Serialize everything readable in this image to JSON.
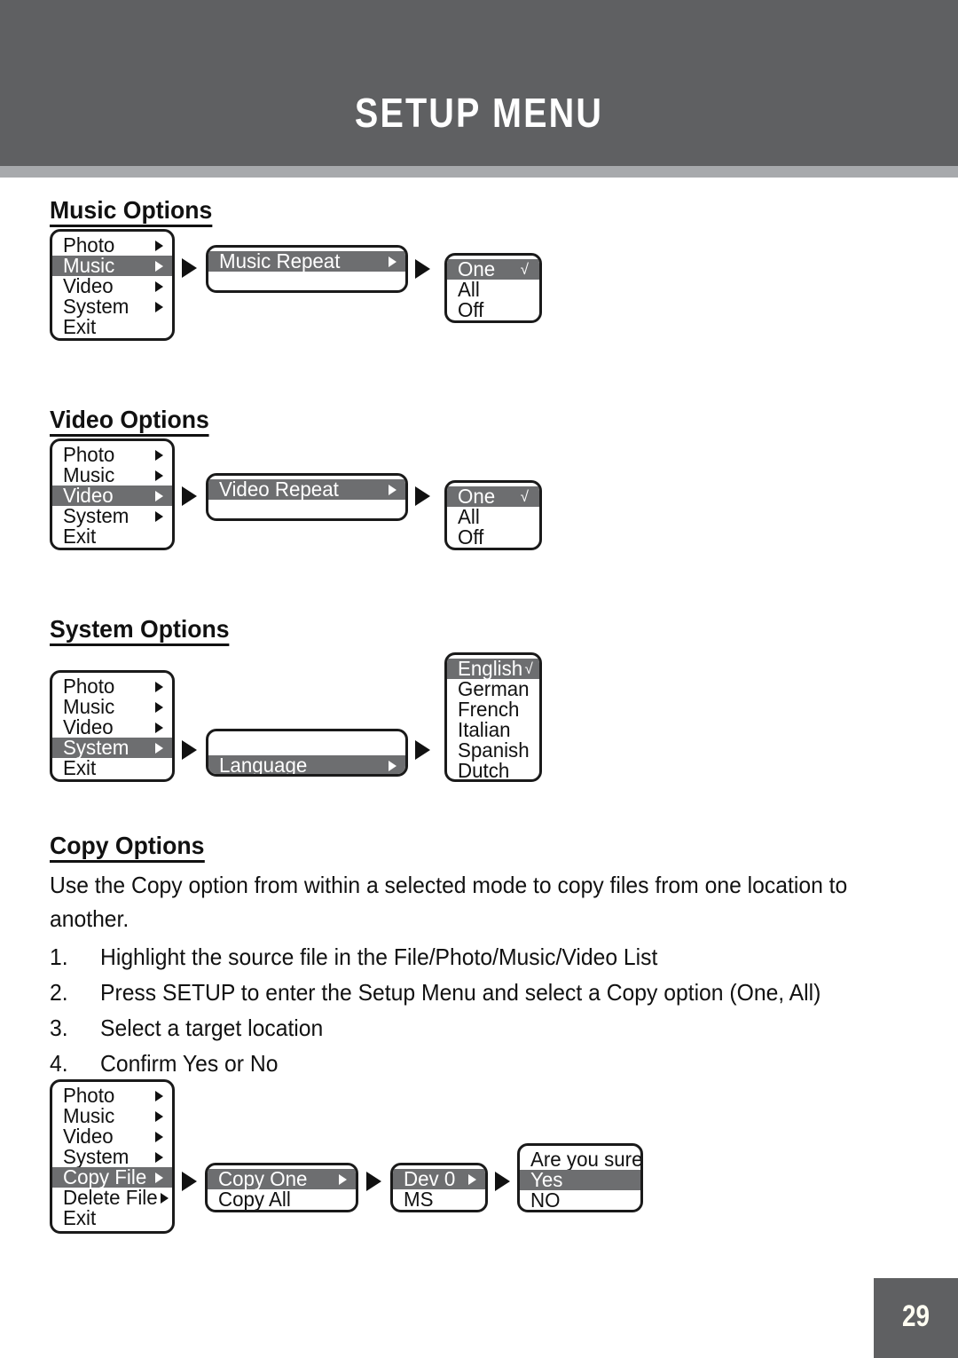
{
  "header": {
    "title": "SETUP MENU",
    "bg_color": "#5f6062",
    "rule_color": "#a7a9ac"
  },
  "page_number": "29",
  "highlight_color": "#6d6e70",
  "sections": {
    "music": {
      "heading": "Music Options",
      "main_menu": [
        {
          "label": "Photo",
          "caret": true,
          "highlighted": false
        },
        {
          "label": "Music",
          "caret": true,
          "highlighted": true
        },
        {
          "label": "Video",
          "caret": true,
          "highlighted": false
        },
        {
          "label": "System",
          "caret": true,
          "highlighted": false
        },
        {
          "label": "Exit",
          "caret": false,
          "highlighted": false
        }
      ],
      "sub_menu": [
        {
          "label": "Music Repeat",
          "caret": true,
          "highlighted": true
        },
        {
          "label": "",
          "caret": false,
          "highlighted": false
        }
      ],
      "values": [
        {
          "label": "One",
          "check": "√",
          "highlighted": true
        },
        {
          "label": "All",
          "check": "",
          "highlighted": false
        },
        {
          "label": "Off",
          "check": "",
          "highlighted": false
        }
      ]
    },
    "video": {
      "heading": "Video Options",
      "main_menu": [
        {
          "label": "Photo",
          "caret": true,
          "highlighted": false
        },
        {
          "label": "Music",
          "caret": true,
          "highlighted": false
        },
        {
          "label": "Video",
          "caret": true,
          "highlighted": true
        },
        {
          "label": "System",
          "caret": true,
          "highlighted": false
        },
        {
          "label": "Exit",
          "caret": false,
          "highlighted": false
        }
      ],
      "sub_menu": [
        {
          "label": "Video Repeat",
          "caret": true,
          "highlighted": true
        },
        {
          "label": "",
          "caret": false,
          "highlighted": false
        }
      ],
      "values": [
        {
          "label": "One",
          "check": "√",
          "highlighted": true
        },
        {
          "label": "All",
          "check": "",
          "highlighted": false
        },
        {
          "label": "Off",
          "check": "",
          "highlighted": false
        }
      ]
    },
    "system": {
      "heading": "System Options",
      "main_menu": [
        {
          "label": "Photo",
          "caret": true,
          "highlighted": false
        },
        {
          "label": "Music",
          "caret": true,
          "highlighted": false
        },
        {
          "label": "Video",
          "caret": true,
          "highlighted": false
        },
        {
          "label": "System",
          "caret": true,
          "highlighted": true
        },
        {
          "label": "Exit",
          "caret": false,
          "highlighted": false
        }
      ],
      "sub_menu": [
        {
          "label": "",
          "caret": false,
          "highlighted": false
        },
        {
          "label": "Language",
          "caret": true,
          "highlighted": true
        },
        {
          "label": "",
          "caret": false,
          "highlighted": false
        }
      ],
      "values": [
        {
          "label": "English",
          "check": "√",
          "highlighted": true
        },
        {
          "label": "German",
          "check": "",
          "highlighted": false
        },
        {
          "label": "French",
          "check": "",
          "highlighted": false
        },
        {
          "label": "Italian",
          "check": "",
          "highlighted": false
        },
        {
          "label": "Spanish",
          "check": "",
          "highlighted": false
        },
        {
          "label": "Dutch",
          "check": "",
          "highlighted": false
        }
      ]
    },
    "copy": {
      "heading": "Copy Options",
      "intro": "Use the Copy option from within a selected mode to copy files from one location to another.",
      "steps": [
        {
          "num": "1.",
          "text": "Highlight the source file in the File/Photo/Music/Video List"
        },
        {
          "num": "2.",
          "text": "Press SETUP to enter the Setup Menu and select a Copy option (One, All)"
        },
        {
          "num": "3.",
          "text": "Select a target location"
        },
        {
          "num": "4.",
          "text": "Confirm Yes or No"
        }
      ],
      "main_menu": [
        {
          "label": "Photo",
          "caret": true,
          "highlighted": false
        },
        {
          "label": "Music",
          "caret": true,
          "highlighted": false
        },
        {
          "label": "Video",
          "caret": true,
          "highlighted": false
        },
        {
          "label": "System",
          "caret": true,
          "highlighted": false
        },
        {
          "label": "Copy File",
          "caret": true,
          "highlighted": true
        },
        {
          "label": "Delete File",
          "caret": true,
          "highlighted": false
        },
        {
          "label": "Exit",
          "caret": false,
          "highlighted": false
        }
      ],
      "copy_menu": [
        {
          "label": "Copy One",
          "caret": true,
          "highlighted": true
        },
        {
          "label": "Copy All",
          "caret": false,
          "highlighted": false
        }
      ],
      "device_menu": [
        {
          "label": "Dev 0",
          "caret": true,
          "highlighted": true
        },
        {
          "label": "MS",
          "caret": false,
          "highlighted": false
        }
      ],
      "confirm_menu": [
        {
          "label": "Are you sure?",
          "caret": false,
          "highlighted": false
        },
        {
          "label": "Yes",
          "caret": false,
          "highlighted": true
        },
        {
          "label": "NO",
          "caret": false,
          "highlighted": false
        }
      ]
    }
  }
}
